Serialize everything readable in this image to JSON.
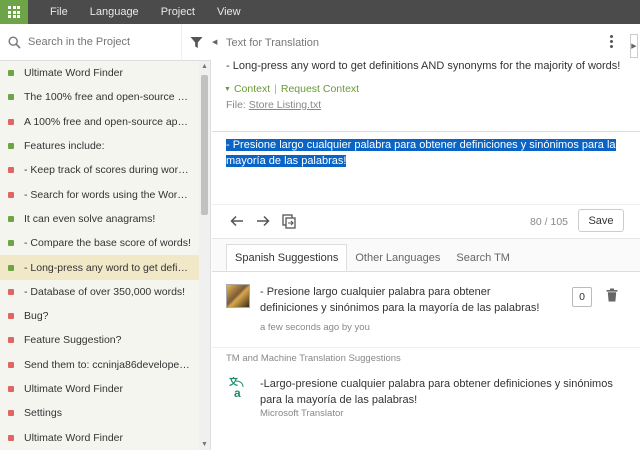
{
  "menu": {
    "items": [
      "File",
      "Language",
      "Project",
      "View"
    ]
  },
  "search": {
    "placeholder": "Search in the Project"
  },
  "strings": [
    {
      "text": "Ultimate Word Finder",
      "status": "translated"
    },
    {
      "text": "The 100% free and open-source app f...",
      "status": "translated"
    },
    {
      "text": "A 100% free and open-source app tha...",
      "status": "untranslated"
    },
    {
      "text": "Features include:",
      "status": "translated"
    },
    {
      "text": "- Keep track of scores during word ga...",
      "status": "untranslated"
    },
    {
      "text": "- Search for words using the Word Fin...",
      "status": "untranslated"
    },
    {
      "text": "It can even solve anagrams!",
      "status": "translated"
    },
    {
      "text": "- Compare the base score of words!",
      "status": "translated"
    },
    {
      "text": "- Long-press any word to get definitio...",
      "status": "translated",
      "selected": true
    },
    {
      "text": "- Database of over 350,000 words!",
      "status": "untranslated"
    },
    {
      "text": "Bug?",
      "status": "untranslated"
    },
    {
      "text": "Feature Suggestion?",
      "status": "untranslated"
    },
    {
      "text": "Send them to: ccninja86developer@g...",
      "status": "untranslated"
    },
    {
      "text": "Ultimate Word Finder",
      "status": "untranslated"
    },
    {
      "text": "Settings",
      "status": "untranslated"
    },
    {
      "text": "Ultimate Word Finder",
      "status": "untranslated"
    }
  ],
  "status_colors": {
    "translated": "#6da447",
    "untranslated": "#e06666"
  },
  "panel": {
    "title": "Text for Translation",
    "source": "- Long-press any word to get definitions AND synonyms for the majority of words!",
    "context_label": "Context",
    "request_context_label": "Request Context",
    "file_label": "File:",
    "file_name": "Store Listing.txt"
  },
  "translation": {
    "text": "- Presione largo cualquier palabra para obtener definiciones y sinónimos para la mayoría de las palabras!",
    "counter": "80 / 105",
    "save_label": "Save"
  },
  "tabs": [
    "Spanish Suggestions",
    "Other Languages",
    "Search TM"
  ],
  "suggestion": {
    "text": "- Presione largo cualquier palabra para obtener definiciones y sinónimos para la mayoría de las palabras!",
    "meta": "a few seconds ago by you",
    "votes": "0"
  },
  "mt": {
    "header": "TM and Machine Translation Suggestions",
    "text": "-Largo-presione cualquier palabra para obtener definiciones y sinónimos para la mayoría de las palabras!",
    "source": "Microsoft Translator"
  }
}
